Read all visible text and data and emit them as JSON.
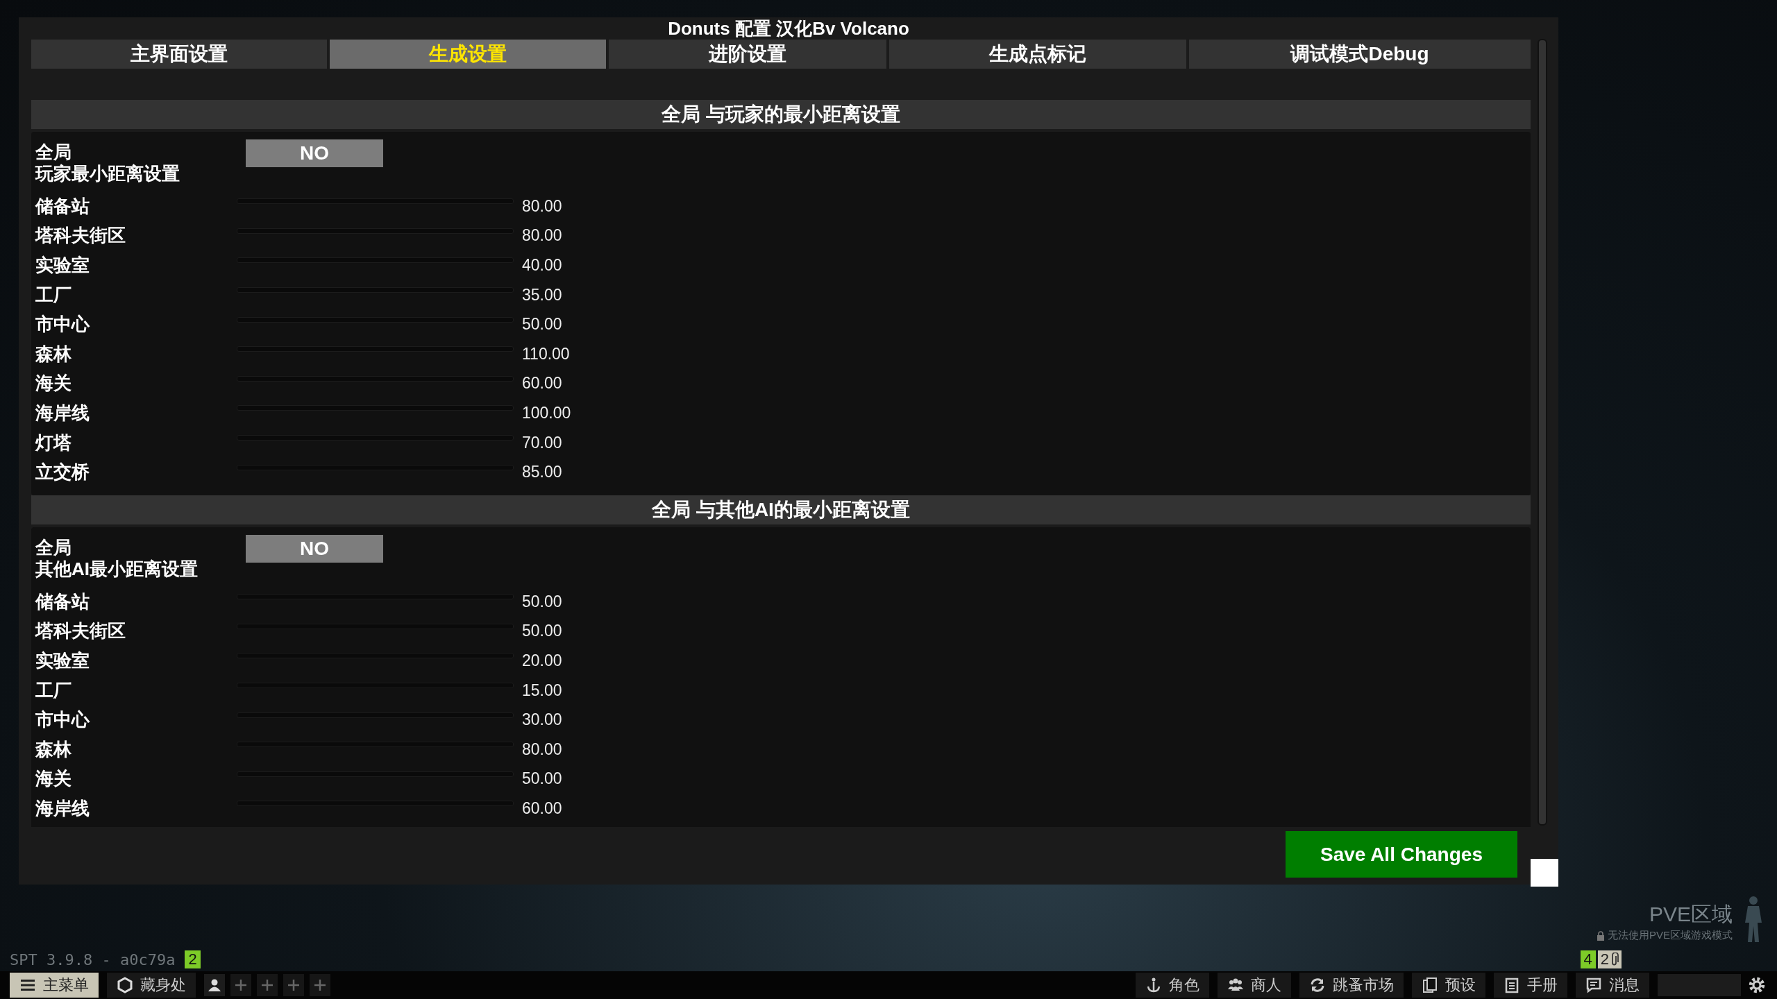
{
  "window": {
    "title": "Donuts 配置 汉化Bv Volcano"
  },
  "tabs": [
    {
      "label": "主界面设置",
      "selected": false
    },
    {
      "label": "生成设置",
      "selected": true
    },
    {
      "label": "进阶设置",
      "selected": false
    },
    {
      "label": "生成点标记",
      "selected": false
    },
    {
      "label": "调试模式Debug",
      "selected": false
    }
  ],
  "sections": [
    {
      "title": "全局 与玩家的最小距离设置",
      "toggle": {
        "label_lines": [
          "全局",
          "玩家最小距离设置"
        ],
        "value": "NO"
      },
      "rows": [
        {
          "label": "储备站",
          "reading": "80.00"
        },
        {
          "label": "塔科夫街区",
          "reading": "80.00"
        },
        {
          "label": "实验室",
          "reading": "40.00"
        },
        {
          "label": "工厂",
          "reading": "35.00"
        },
        {
          "label": "市中心",
          "reading": "50.00"
        },
        {
          "label": "森林",
          "reading": "110.00"
        },
        {
          "label": "海关",
          "reading": "60.00"
        },
        {
          "label": "海岸线",
          "reading": "100.00"
        },
        {
          "label": "灯塔",
          "reading": "70.00"
        },
        {
          "label": "立交桥",
          "reading": "85.00"
        }
      ]
    },
    {
      "title": "全局 与其他AI的最小距离设置",
      "toggle": {
        "label_lines": [
          "全局",
          "其他AI最小距离设置"
        ],
        "value": "NO"
      },
      "rows": [
        {
          "label": "储备站",
          "reading": "50.00"
        },
        {
          "label": "塔科夫街区",
          "reading": "50.00"
        },
        {
          "label": "实验室",
          "reading": "20.00"
        },
        {
          "label": "工厂",
          "reading": "15.00"
        },
        {
          "label": "市中心",
          "reading": "30.00"
        },
        {
          "label": "森林",
          "reading": "80.00"
        },
        {
          "label": "海关",
          "reading": "50.00"
        },
        {
          "label": "海岸线",
          "reading": "60.00"
        }
      ]
    }
  ],
  "save_button": "Save All Changes",
  "version": "SPT 3.9.8 - a0c79a",
  "version_badge": "2",
  "pve": {
    "title": "PVE区域",
    "note": "无法使用PVE区域游戏模式"
  },
  "counters": [
    "4",
    "2"
  ],
  "taskbar": {
    "left": [
      {
        "label": "主菜单",
        "selected": true
      },
      {
        "label": "藏身处",
        "selected": false
      }
    ],
    "right": [
      {
        "label": "角色"
      },
      {
        "label": "商人"
      },
      {
        "label": "跳蚤市场"
      },
      {
        "label": "预设"
      },
      {
        "label": "手册"
      },
      {
        "label": "消息"
      }
    ]
  }
}
